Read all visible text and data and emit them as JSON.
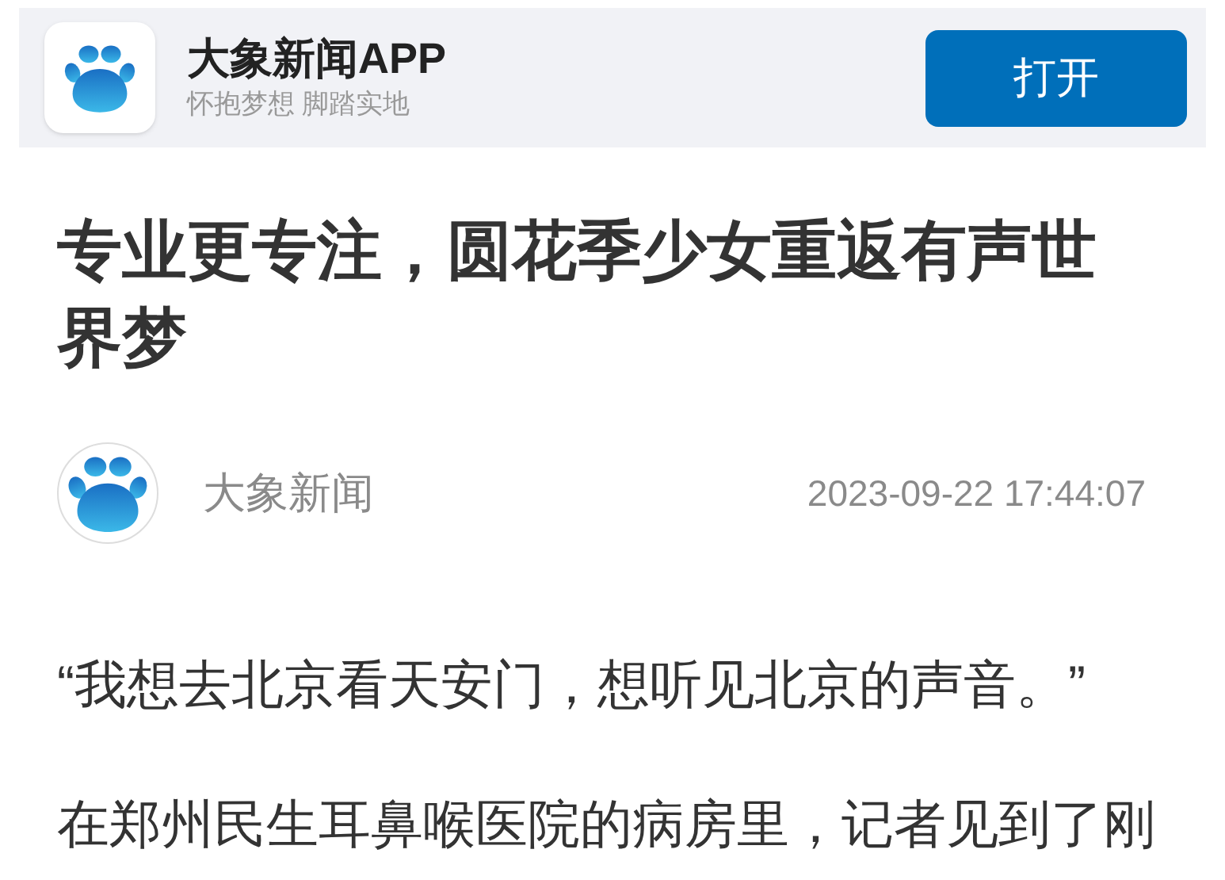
{
  "app_banner": {
    "app_name": "大象新闻APP",
    "slogan": "怀抱梦想 脚踏实地",
    "open_button": "打开"
  },
  "article": {
    "headline": "专业更专注，圆花季少女重返有声世界梦",
    "source": "大象新闻",
    "published": "2023-09-22 17:44:07",
    "paragraphs": [
      "“我想去北京看天安门，想听见北京的声音。”",
      "在郑州民生耳鼻喉医院的病房里，记者见到了刚"
    ]
  }
}
